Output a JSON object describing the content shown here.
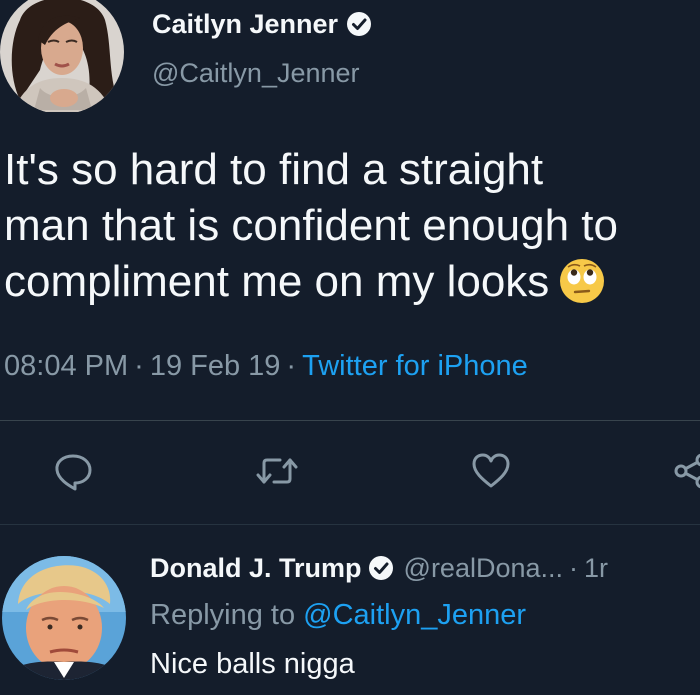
{
  "main_tweet": {
    "author_name": "Caitlyn Jenner",
    "author_handle": "@Caitlyn_Jenner",
    "verified_icon": "verified-badge-icon",
    "text_lines": [
      "It's so hard to find a straight",
      "man that is confident enough to",
      "compliment me on my looks"
    ],
    "emoji": "face-with-rolling-eyes",
    "time": "08:04 PM",
    "separator": "·",
    "date": "19 Feb 19",
    "source": "Twitter for iPhone",
    "actions": [
      "reply-icon",
      "retweet-icon",
      "like-icon",
      "share-icon"
    ]
  },
  "reply": {
    "author_name": "Donald J. Trump",
    "author_handle": "@realDona...",
    "separator": "·",
    "time": "1r",
    "replying_label": "Replying to",
    "replying_to": "@Caitlyn_Jenner",
    "text": "Nice balls nigga"
  },
  "colors": {
    "background": "#141d2b",
    "text": "#f5f8fa",
    "muted": "#8899a6",
    "accent": "#1da1f2"
  }
}
